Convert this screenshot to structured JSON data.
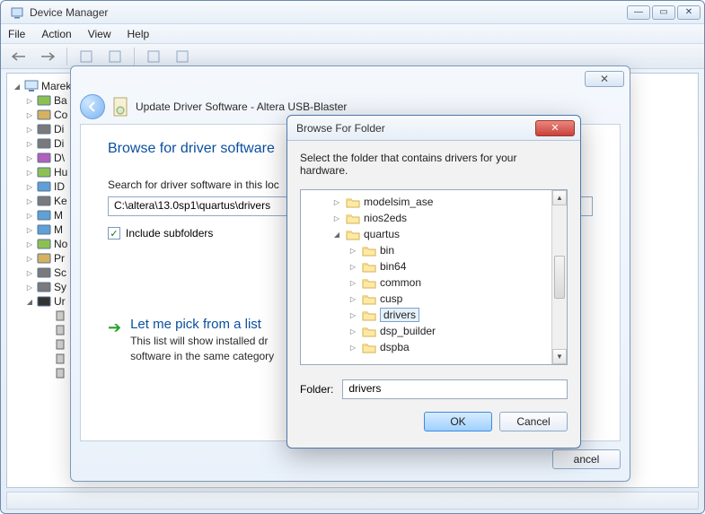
{
  "dm": {
    "title": "Device Manager",
    "menu": {
      "file": "File",
      "action": "Action",
      "view": "View",
      "help": "Help"
    },
    "tree": {
      "root": "Marek",
      "items": [
        "Ba",
        "Co",
        "Di",
        "Di",
        "D\\",
        "Hu",
        "ID",
        "Ke",
        "M",
        "M",
        "No",
        "Pr",
        "Sc",
        "Sy",
        "Ur"
      ]
    }
  },
  "wiz": {
    "title": "Update Driver Software - Altera USB-Blaster",
    "heading": "Browse for driver software",
    "search_label": "Search for driver software in this loc",
    "path": "C:\\altera\\13.0sp1\\quartus\\drivers",
    "include_subfolders": "Include subfolders",
    "option_title": "Let me pick from a list",
    "option_desc_line1": "This list will show installed dr",
    "option_desc_line2": "software in the same category",
    "cancel": "ancel"
  },
  "bff": {
    "title": "Browse For Folder",
    "instr": "Select the folder that contains drivers for your hardware.",
    "tree": [
      {
        "indent": 1,
        "caret": "closed",
        "label": "modelsim_ase"
      },
      {
        "indent": 1,
        "caret": "closed",
        "label": "nios2eds"
      },
      {
        "indent": 1,
        "caret": "open",
        "label": "quartus"
      },
      {
        "indent": 2,
        "caret": "closed",
        "label": "bin"
      },
      {
        "indent": 2,
        "caret": "closed",
        "label": "bin64"
      },
      {
        "indent": 2,
        "caret": "closed",
        "label": "common"
      },
      {
        "indent": 2,
        "caret": "closed",
        "label": "cusp"
      },
      {
        "indent": 2,
        "caret": "closed",
        "label": "drivers",
        "selected": true
      },
      {
        "indent": 2,
        "caret": "closed",
        "label": "dsp_builder"
      },
      {
        "indent": 2,
        "caret": "closed",
        "label": "dspba"
      }
    ],
    "folder_label": "Folder:",
    "folder_value": "drivers",
    "ok": "OK",
    "cancel": "Cancel"
  }
}
